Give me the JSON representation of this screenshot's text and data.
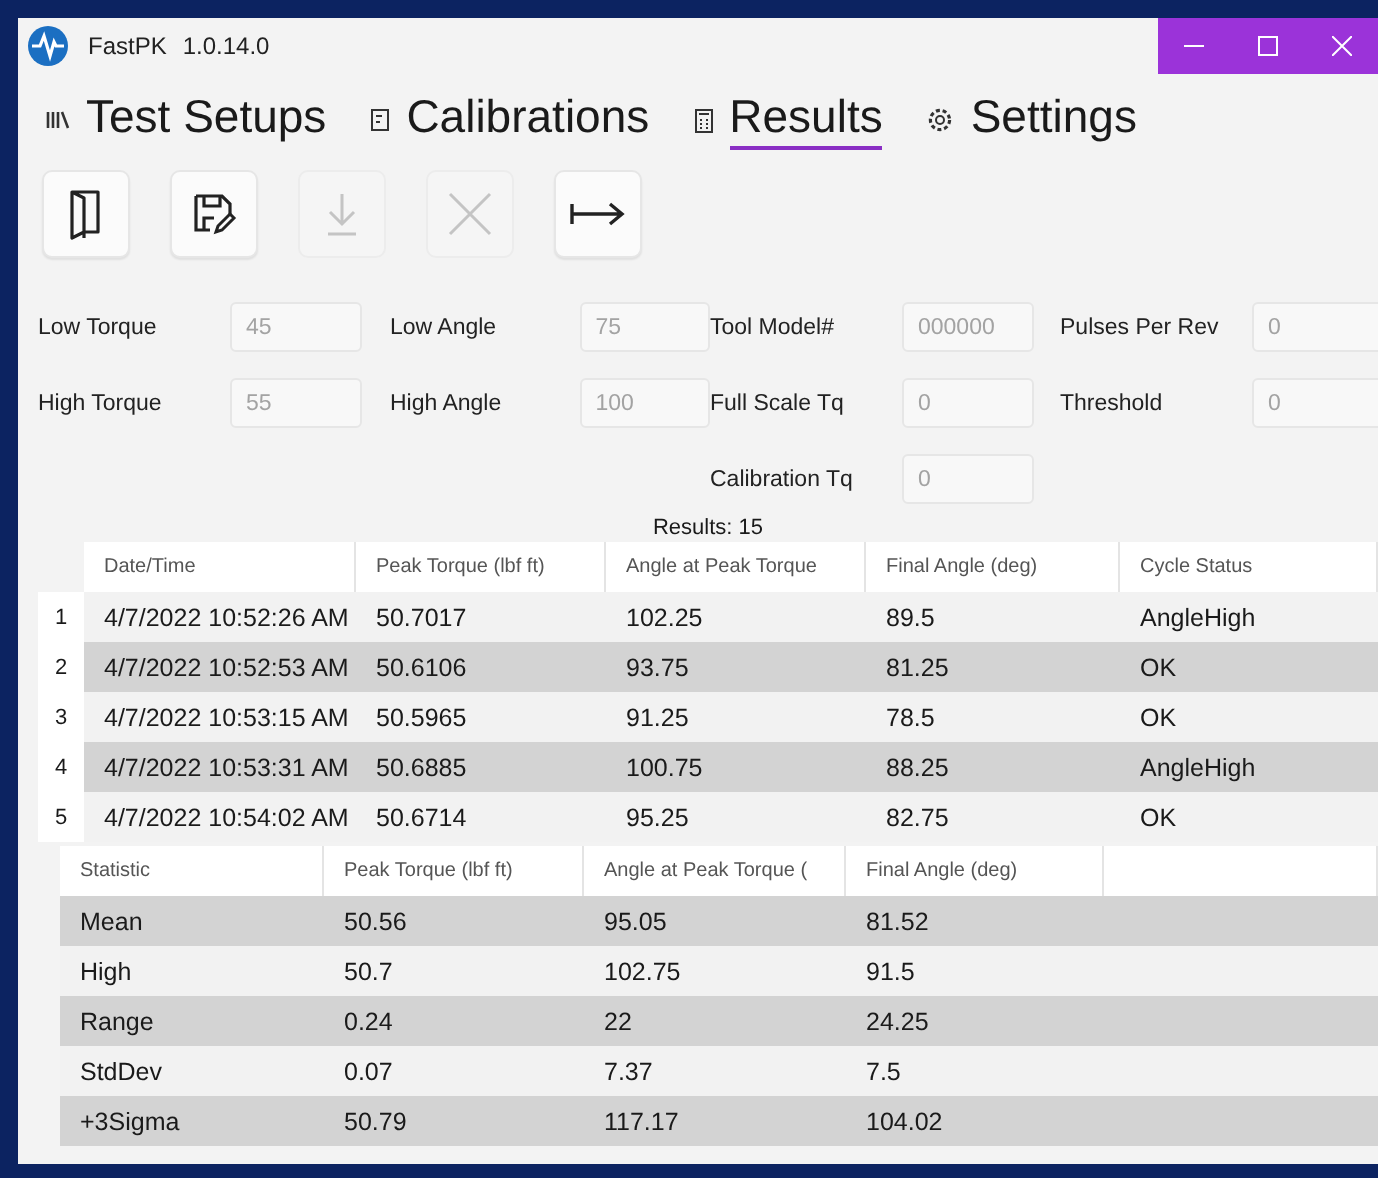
{
  "window": {
    "app_name": "FastPK",
    "version": "1.0.14.0"
  },
  "tabs": [
    {
      "label": "Test Setups",
      "selected": false
    },
    {
      "label": "Calibrations",
      "selected": false
    },
    {
      "label": "Results",
      "selected": true
    },
    {
      "label": "Settings",
      "selected": false
    }
  ],
  "toolbar": [
    {
      "disabled": false
    },
    {
      "disabled": false
    },
    {
      "disabled": true
    },
    {
      "disabled": true
    },
    {
      "disabled": false
    }
  ],
  "form": {
    "columns": [
      [
        {
          "label": "Low Torque",
          "value": "45",
          "disabled": true
        },
        {
          "label": "High Torque",
          "value": "55",
          "disabled": true
        }
      ],
      [
        {
          "label": "Low Angle",
          "value": "75",
          "disabled": true
        },
        {
          "label": "High Angle",
          "value": "100",
          "disabled": true
        }
      ],
      [
        {
          "label": "Tool Model#",
          "value": "000000",
          "disabled": true
        },
        {
          "label": "Full Scale Tq",
          "value": "0",
          "disabled": true
        },
        {
          "label": "Calibration Tq",
          "value": "0",
          "disabled": true
        }
      ],
      [
        {
          "label": "Pulses Per Rev",
          "value": "0",
          "disabled": true
        },
        {
          "label": "Threshold",
          "value": "0",
          "disabled": true
        }
      ]
    ]
  },
  "results_count": "Results: 15",
  "results_table": {
    "columns": [
      "Date/Time",
      "Peak Torque (lbf ft)",
      "Angle at Peak Torque",
      "Final Angle (deg)",
      "Cycle Status"
    ],
    "rows": [
      {
        "number": "1",
        "cells": [
          "4/7/2022 10:52:26 AM",
          "50.7017",
          "102.25",
          "89.5",
          "AngleHigh"
        ]
      },
      {
        "number": "2",
        "cells": [
          "4/7/2022 10:52:53 AM",
          "50.6106",
          "93.75",
          "81.25",
          "OK"
        ]
      },
      {
        "number": "3",
        "cells": [
          "4/7/2022 10:53:15 AM",
          "50.5965",
          "91.25",
          "78.5",
          "OK"
        ]
      },
      {
        "number": "4",
        "cells": [
          "4/7/2022 10:53:31 AM",
          "50.6885",
          "100.75",
          "88.25",
          "AngleHigh"
        ]
      },
      {
        "number": "5",
        "cells": [
          "4/7/2022 10:54:02 AM",
          "50.6714",
          "95.25",
          "82.75",
          "OK"
        ]
      }
    ]
  },
  "stats_table": {
    "columns": [
      "Statistic",
      "Peak Torque (lbf ft)",
      "Angle at Peak Torque (",
      "Final Angle (deg)"
    ],
    "rows": [
      [
        "Mean",
        "50.56",
        "95.05",
        "81.52"
      ],
      [
        "High",
        "50.7",
        "102.75",
        "91.5"
      ],
      [
        "Range",
        "0.24",
        "22",
        "24.25"
      ],
      [
        "StdDev",
        "0.07",
        "7.37",
        "7.5"
      ],
      [
        "+3Sigma",
        "50.79",
        "117.17",
        "104.02"
      ]
    ]
  }
}
